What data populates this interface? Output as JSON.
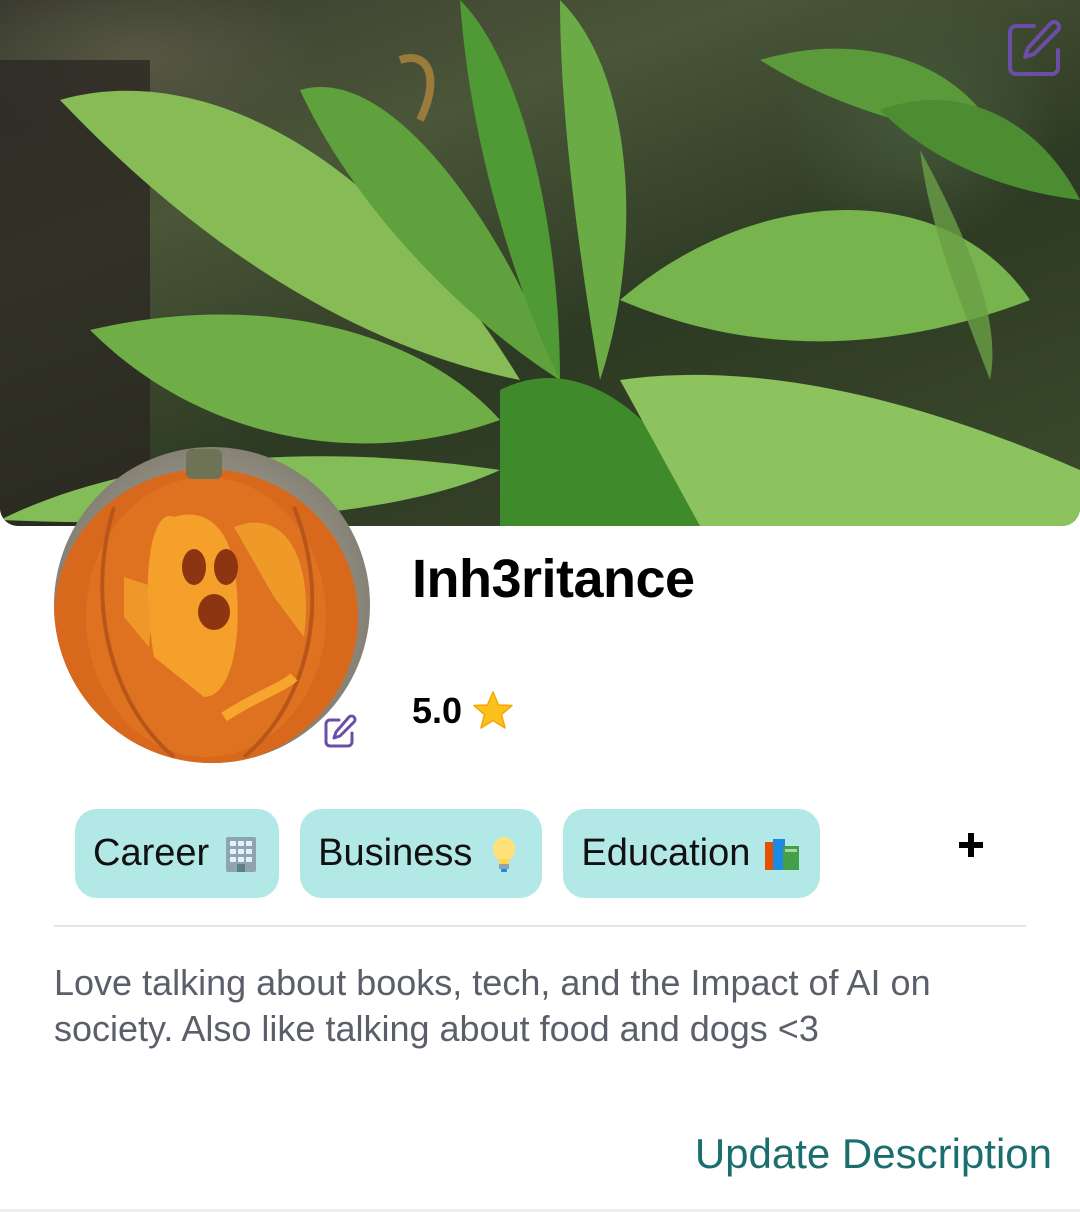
{
  "profile": {
    "username": "Inh3ritance",
    "rating": "5.0",
    "rating_icon": "star-icon"
  },
  "tags": [
    {
      "label": "Career",
      "icon": "office-building-icon"
    },
    {
      "label": "Business",
      "icon": "light-bulb-icon"
    },
    {
      "label": "Education",
      "icon": "books-icon"
    }
  ],
  "actions": {
    "add_tag_icon": "plus-icon",
    "edit_cover_icon": "edit-icon",
    "edit_avatar_icon": "edit-icon"
  },
  "description": {
    "text": "Love talking about books, tech, and the Impact of AI on society. Also like talking about food and dogs <3",
    "update_label": "Update Description"
  },
  "colors": {
    "tag_background": "#b2e8e6",
    "link": "#1b6e6e",
    "edit_icon": "#6b4ea8",
    "description_text": "#5b5f6a"
  }
}
